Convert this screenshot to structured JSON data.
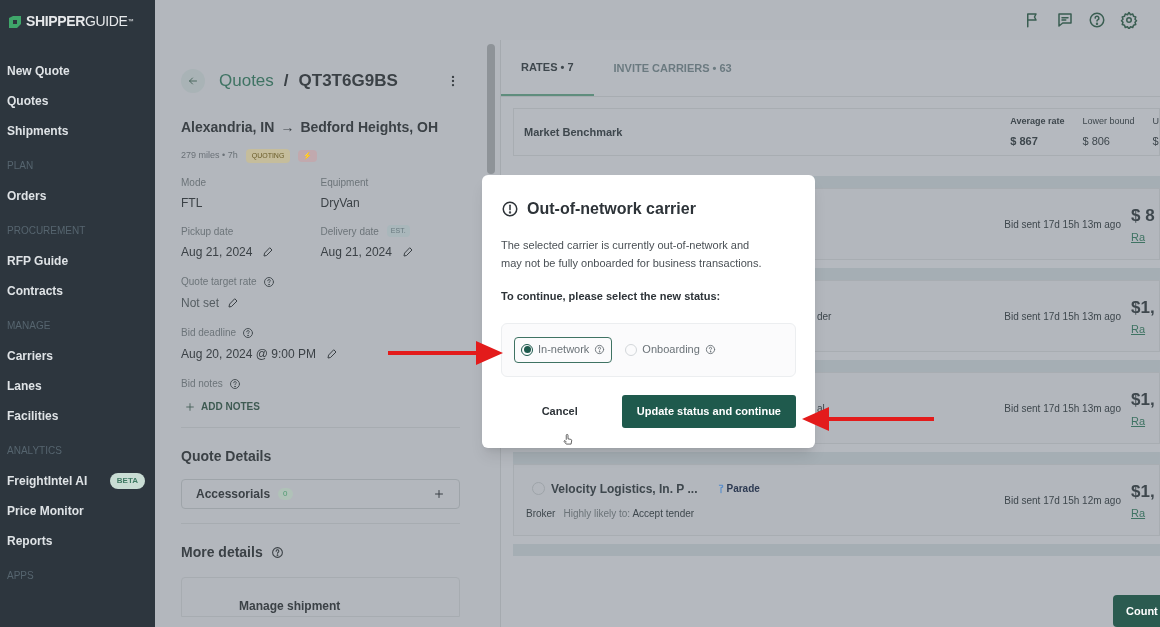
{
  "sidebar": {
    "logo": {
      "bold": "SHIPPER",
      "light": "GUIDE",
      "mark": "™"
    },
    "sections": [
      {
        "items": [
          {
            "label": "New Quote"
          },
          {
            "label": "Quotes"
          },
          {
            "label": "Shipments"
          }
        ]
      },
      {
        "heading": "PLAN",
        "items": [
          {
            "label": "Orders"
          }
        ]
      },
      {
        "heading": "PROCUREMENT",
        "items": [
          {
            "label": "RFP Guide"
          },
          {
            "label": "Contracts"
          }
        ]
      },
      {
        "heading": "MANAGE",
        "items": [
          {
            "label": "Carriers"
          },
          {
            "label": "Lanes"
          },
          {
            "label": "Facilities"
          }
        ]
      },
      {
        "heading": "ANALYTICS",
        "items": [
          {
            "label": "FreightIntel AI",
            "badge": "BETA"
          },
          {
            "label": "Price Monitor"
          },
          {
            "label": "Reports"
          }
        ]
      },
      {
        "heading": "APPS"
      }
    ]
  },
  "quote": {
    "breadcrumb": "Quotes",
    "separator": "/",
    "id": "QT3T6G9BS",
    "origin": "Alexandria, IN",
    "arrow": "→",
    "destination": "Bedford Heights, OH",
    "meta": "279 miles • 7h",
    "status": "QUOTING",
    "flag": "⚡",
    "fields": [
      {
        "label": "Mode",
        "value": "FTL"
      },
      {
        "label": "Equipment",
        "value": "DryVan"
      },
      {
        "label": "Pickup date",
        "value": "Aug 21, 2024",
        "editable": true
      },
      {
        "label": "Delivery date",
        "badge": "EST.",
        "value": "Aug 21, 2024",
        "editable": true
      }
    ],
    "target_rate": {
      "label": "Quote target rate",
      "value": "Not set"
    },
    "bid_deadline": {
      "label": "Bid deadline",
      "value": "Aug 20, 2024 @ 9:00 PM"
    },
    "bid_notes": {
      "label": "Bid notes",
      "action": "ADD NOTES"
    },
    "details_heading": "Quote Details",
    "accessorials": {
      "label": "Accessorials",
      "count": "0"
    },
    "more_heading": "More details",
    "manage": "Manage shipment"
  },
  "rates": {
    "tabs": [
      {
        "label": "RATES • 7",
        "selected": true
      },
      {
        "label": "INVITE CARRIERS • 63",
        "selected": false
      }
    ],
    "benchmark": {
      "title": "Market Benchmark",
      "stats": [
        {
          "label": "Average rate",
          "value": "$ 867"
        },
        {
          "label": "Lower bound",
          "value": "$ 806"
        },
        {
          "label": "U",
          "value": "$"
        }
      ]
    },
    "rows": [
      {
        "fragment": "",
        "bid": "Bid sent 17d 15h 13m ago",
        "price": "$ 8",
        "link": "Ra"
      },
      {
        "fragment": "der",
        "bid": "Bid sent 17d 15h 13m ago",
        "price": "$1,",
        "link": "Ra"
      },
      {
        "fragment": "al",
        "bid": "Bid sent 17d 15h 13m ago",
        "price": "$1,",
        "link": "Ra"
      },
      {
        "name": "Velocity Logistics, In. P ...",
        "source": "Parade",
        "type": "Broker",
        "likely_label": "Highly likely to:",
        "likely_value": "Accept tender",
        "bid": "Bid sent 17d 15h 12m ago",
        "price": "$1,",
        "link": "Ra",
        "selected": false
      }
    ],
    "counter_button": "Count"
  },
  "dialog": {
    "title": "Out-of-network carrier",
    "body": "The selected carrier is currently out-of-network and may not be fully onboarded for business transactions.",
    "prompt": "To continue, please select the new status:",
    "options": [
      {
        "label": "In-network",
        "selected": true
      },
      {
        "label": "Onboarding",
        "selected": false
      }
    ],
    "cancel": "Cancel",
    "confirm": "Update status and continue"
  }
}
